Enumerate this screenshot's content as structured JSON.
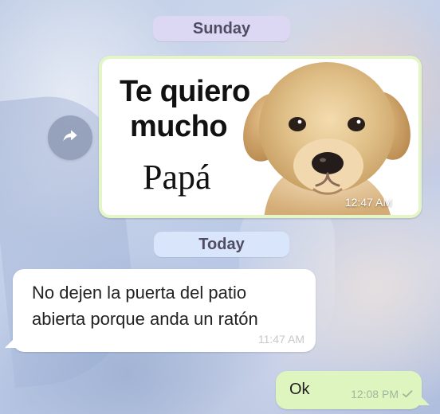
{
  "conversation": {
    "sunday_label": "Sunday",
    "today_label": "Today",
    "image_message": {
      "line_1": "Te quiero",
      "line_2": "mucho",
      "line_3": "Papá",
      "time": "12:47 AM",
      "status_icon": "double-check-icon"
    },
    "incoming_message": {
      "text": "No dejen la puerta del patio abierta porque anda un ratón",
      "time": "11:47 AM"
    },
    "outgoing_message": {
      "text": "Ok",
      "time": "12:08 PM",
      "status_icon": "single-check-icon"
    }
  },
  "icons": {
    "forward": "forward-icon",
    "puppy": "puppy-image"
  },
  "colors": {
    "date_sunday_bg": "#dcd7f2",
    "date_today_bg": "#d8e5fb",
    "bubble_out": "#dff5bf",
    "bubble_in": "#ffffff",
    "sticker_border": "#e4f6c8"
  }
}
